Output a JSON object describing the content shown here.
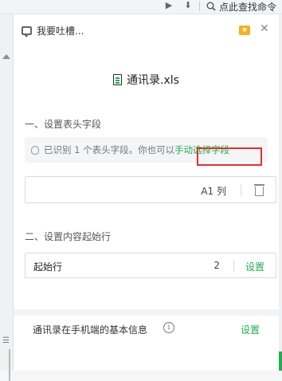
{
  "topbar": {
    "search_text": "点此查找命令",
    "icons": [
      "play-icon",
      "pin-icon",
      "search-icon"
    ]
  },
  "panel": {
    "feedback_label": "我要吐槽...",
    "file_name": "通讯录.xls",
    "section1_title": "一、设置表头字段",
    "tip_text": "已识别 1 个表头字段。你也可以",
    "tip_link": "手动选择字段",
    "field_column": "A1 列",
    "section2_title": "二、设置内容起始行",
    "start_row": {
      "label": "起始行",
      "value": "2",
      "action": "设置"
    },
    "info_row": {
      "label": "通讯录在手机端的基本信息",
      "action": "设置"
    }
  },
  "colors": {
    "accent": "#1fae52",
    "highlight": "#e3302d",
    "folder": "#f7b11a"
  }
}
